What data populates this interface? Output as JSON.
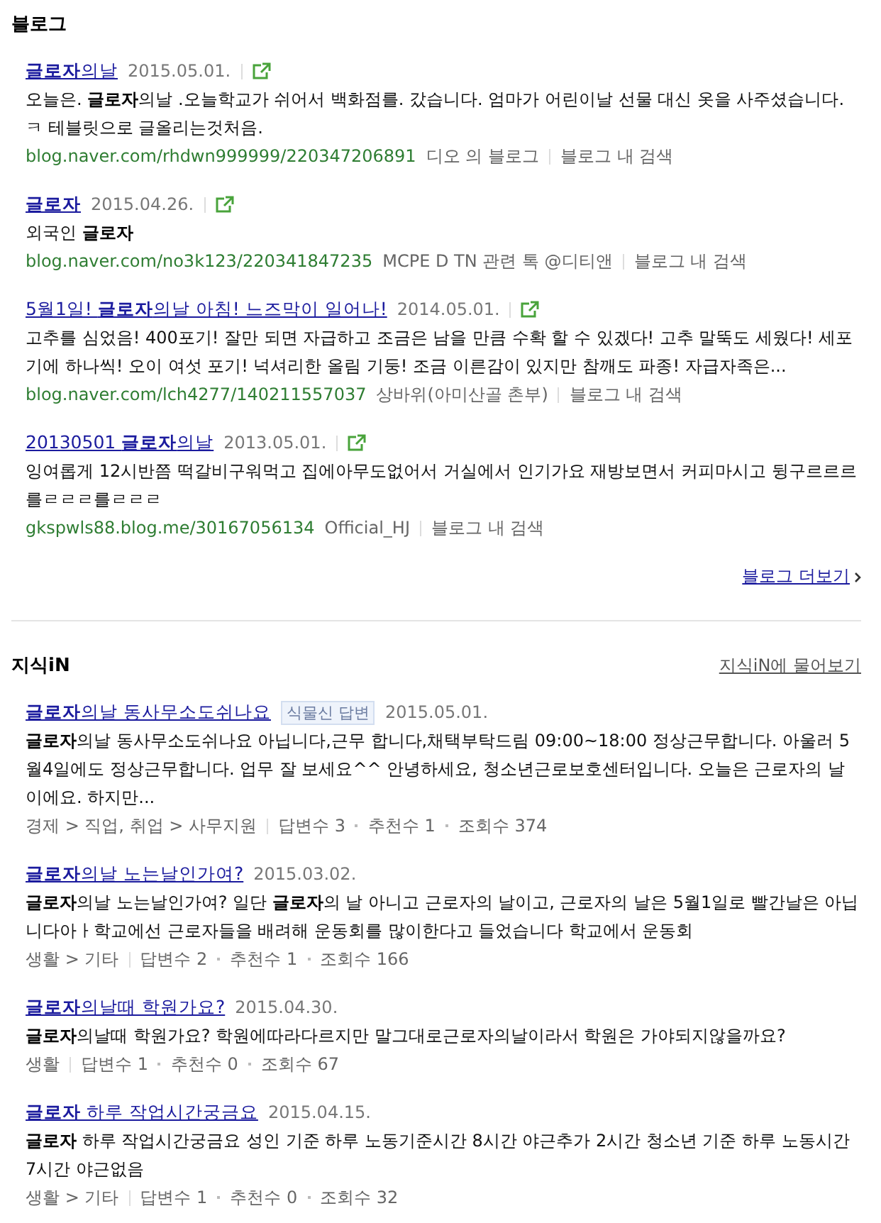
{
  "blog": {
    "title": "블로그",
    "more_link": "블로그 더보기",
    "items": [
      {
        "title": "**글로자**의날",
        "date": "2015.05.01.",
        "body": "오늘은. **글로자**의날 .오늘학교가 쉬어서 백화점를. 갔습니다. 엄마가 어린이날 선물 대신 옷을 사주셨습니다. ㅋ 테블릿으로 글올리는것처음.",
        "url": "blog.naver.com/rhdwn999999/220347206891",
        "author": "디오 의 블로그",
        "search": "블로그 내 검색"
      },
      {
        "title": "**글로자**",
        "date": "2015.04.26.",
        "body": "외국인 **글로자**",
        "url": "blog.naver.com/no3k123/220341847235",
        "author": "MCPE D TN 관련 톡 @디티앤",
        "search": "블로그 내 검색"
      },
      {
        "title": "5월1일! **글로자**의날 아침! 느즈막이 일어나!",
        "date": "2014.05.01.",
        "body": "고추를 심었음! 400포기! 잘만 되면 자급하고 조금은 남을 만큼 수확 할 수 있겠다! 고추 말뚝도 세웠다! 세포기에 하나씩! 오이 여섯 포기! 넉셔리한 올림 기둥! 조금 이른감이 있지만 참깨도 파종! 자급자족은...",
        "url": "blog.naver.com/lch4277/140211557037",
        "author": "상바위(아미산골 촌부)",
        "search": "블로그 내 검색"
      },
      {
        "title": "20130501 **글로자**의날",
        "date": "2013.05.01.",
        "body": "잉여롭게 12시반쯤 떡갈비구워먹고 집에아무도없어서 거실에서 인기가요 재방보면서 커피마시고 뒹구르르르 를ㄹㄹㄹ를ㄹㄹㄹ",
        "url": "gkspwls88.blog.me/30167056134",
        "author": "Official_HJ",
        "search": "블로그 내 검색"
      }
    ]
  },
  "kin": {
    "title": "지식iN",
    "ask_link": "지식iN에 물어보기",
    "items": [
      {
        "title": "**글로자**의날 동사무소도쉬나요",
        "badge": "식물신 답변",
        "date": "2015.05.01.",
        "body": "**글로자**의날 동사무소도쉬나요 아닙니다,근무 합니다,채택부탁드림 09:00~18:00 정상근무합니다. 아울러 5월4일에도 정상근무합니다. 업무 잘 보세요^^ 안녕하세요, 청소년근로보호센터입니다. 오늘은 근로자의 날이에요. 하지만...",
        "category": "경제 > 직업, 취업 > 사무지원",
        "stats": [
          "답변수 3",
          "추천수 1",
          "조회수 374"
        ]
      },
      {
        "title": "**글로자**의날 노는날인가여?",
        "date": "2015.03.02.",
        "body": "**글로자**의날 노는날인가여? 일단 **글로자**의 날 아니고 근로자의 날이고, 근로자의 날은 5월1일로 빨간날은 아닙니다아ㅏ학교에선 근로자들을 배려해 운동회를 많이한다고 들었습니다 학교에서 운동회",
        "category": "생활 > 기타",
        "stats": [
          "답변수 2",
          "추천수 1",
          "조회수 166"
        ]
      },
      {
        "title": "**글로자**의날때 학원가요?",
        "date": "2015.04.30.",
        "body": "**글로자**의날때 학원가요? 학원에따라다르지만 말그대로근로자의날이라서 학원은 가야되지않을까요?",
        "category": "생활",
        "stats": [
          "답변수 1",
          "추천수 0",
          "조회수 67"
        ]
      },
      {
        "title": "**글로자** 하루 작업시간궁금요",
        "date": "2015.04.15.",
        "body": "**글로자** 하루 작업시간궁금요 성인 기준 하루 노동기준시간 8시간 야근추가 2시간 청소년 기준 하루 노동시간 7시간 야근없음",
        "category": "생활 > 기타",
        "stats": [
          "답변수 1",
          "추천수 0",
          "조회수 32"
        ]
      }
    ]
  }
}
